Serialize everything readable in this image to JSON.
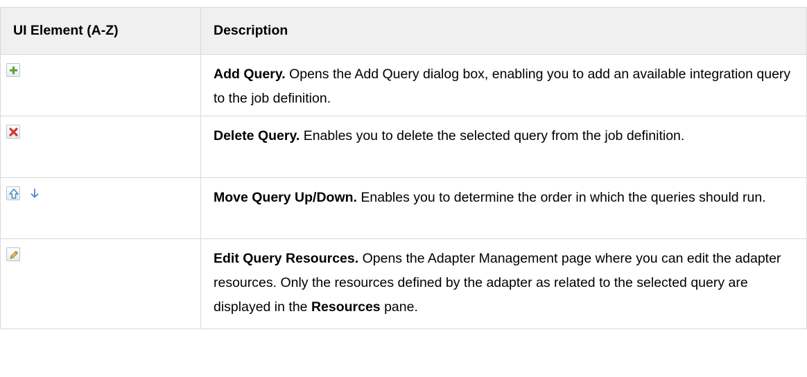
{
  "table": {
    "headers": {
      "element": "UI Element (A-Z)",
      "description": "Description"
    },
    "rows": [
      {
        "icons": [
          "add-icon"
        ],
        "term": "Add Query.",
        "text": " Opens the Add Query dialog box, enabling you to add an available integration query to the job definition."
      },
      {
        "icons": [
          "delete-icon"
        ],
        "term": "Delete Query.",
        "text": " Enables you to delete the selected query from the job definition."
      },
      {
        "icons": [
          "arrow-up-icon",
          "arrow-down-icon"
        ],
        "term": "Move Query Up/Down.",
        "text": " Enables you to determine the order in which the queries should run."
      },
      {
        "icons": [
          "pencil-icon"
        ],
        "term": "Edit Query Resources.",
        "text_before": " Opens the Adapter Management page where you can edit the adapter resources. Only the resources defined by the adapter as related to the selected query are displayed in the ",
        "bold_inline": "Resources",
        "text_after": " pane."
      }
    ]
  },
  "colors": {
    "border": "#d9d9d9",
    "header_bg": "#f0f0f0",
    "add_green": "#5aa532",
    "delete_red": "#d9322a",
    "arrow_blue": "#4a86c8"
  }
}
